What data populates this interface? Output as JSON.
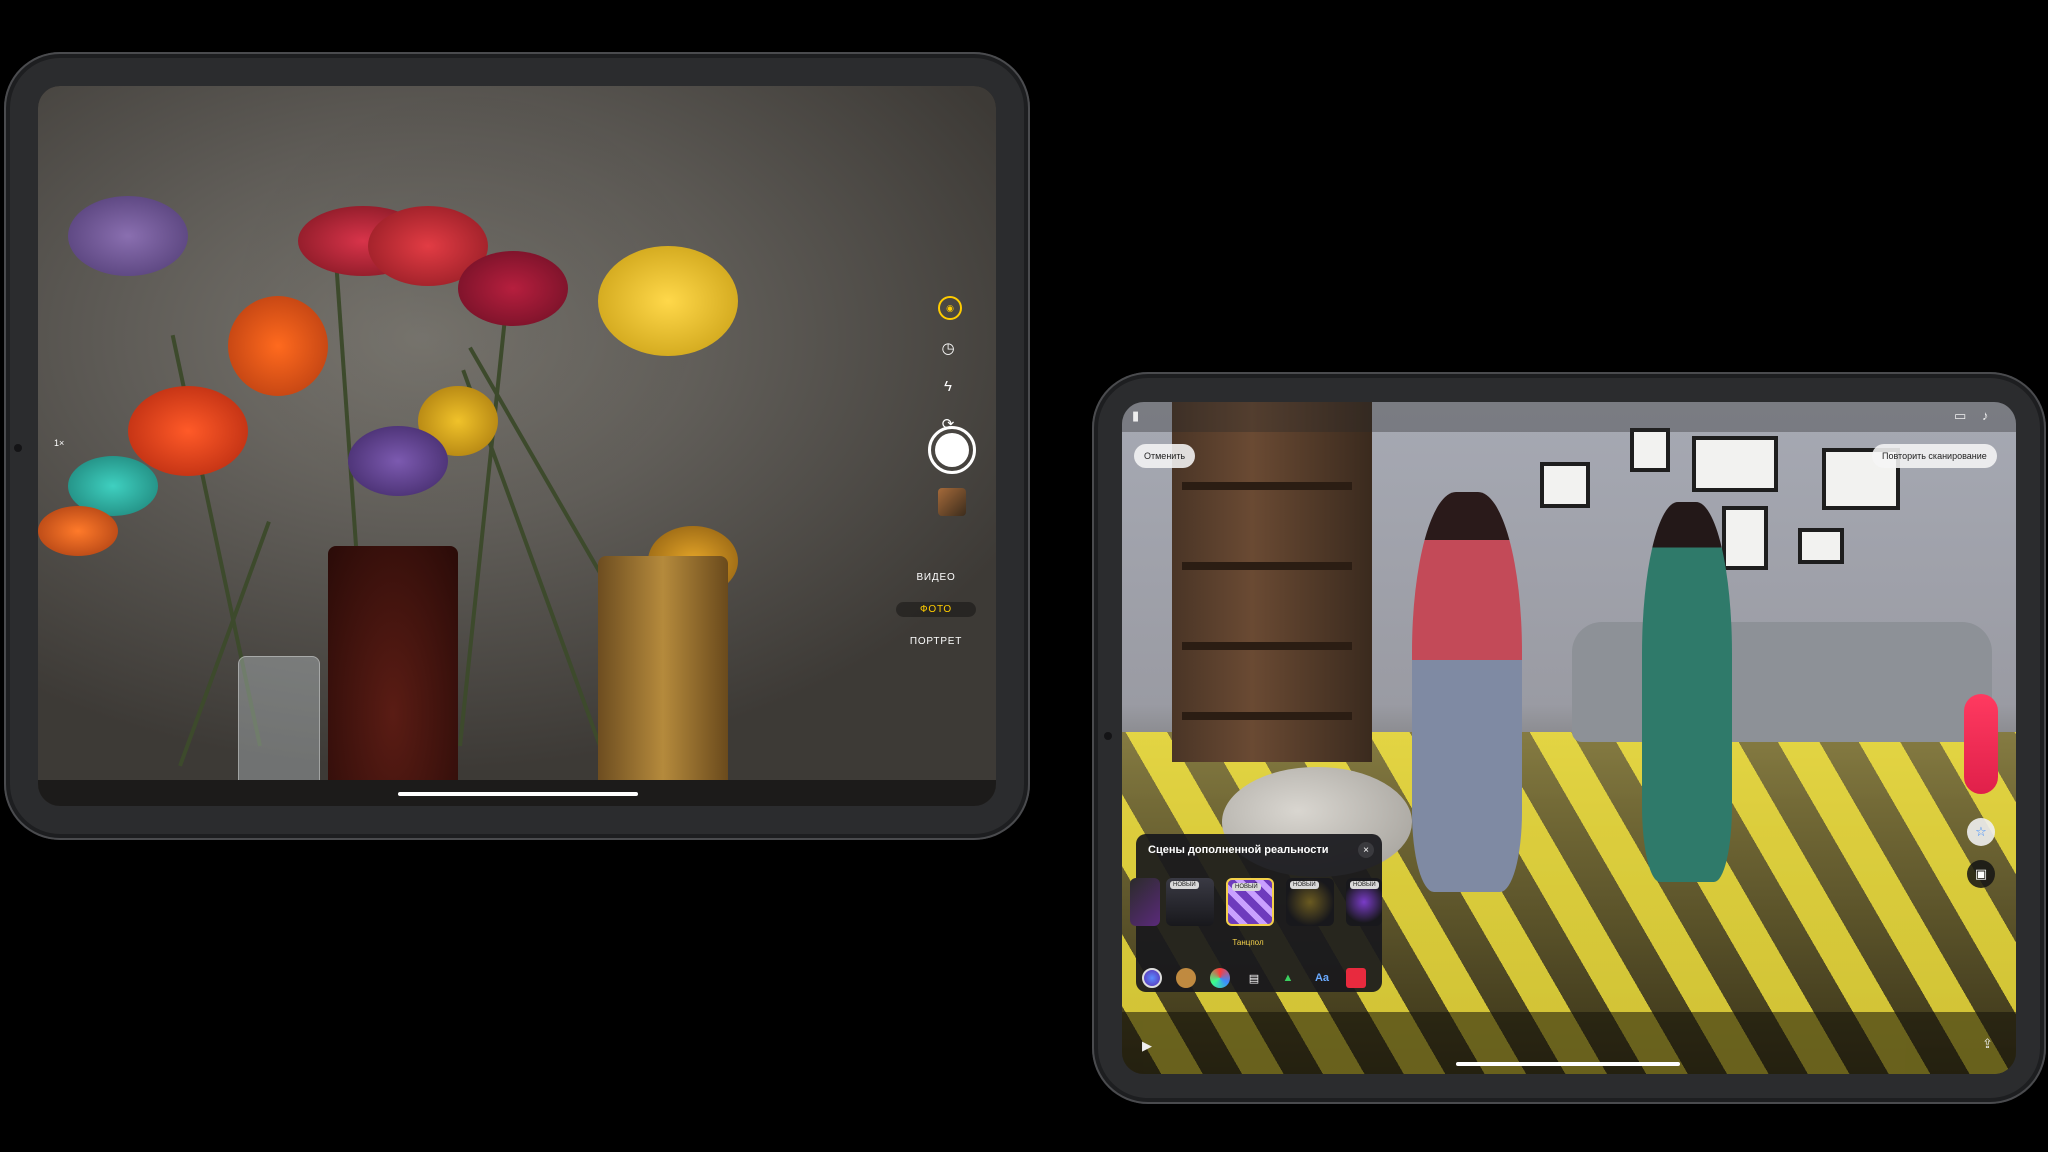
{
  "left_ipad": {
    "zoom_label": "1×",
    "modes": [
      "ВИДЕО",
      "ФОТО",
      "ПОРТРЕТ"
    ],
    "active_mode": "ФОТО",
    "accent_color": "#ffcc00",
    "icons": [
      "live-photo-icon",
      "timer-icon",
      "flash-icon",
      "switch-camera-icon",
      "shutter-button",
      "last-photo-thumbnail"
    ]
  },
  "right_ipad": {
    "cancel_label": "Отменить",
    "rescan_label": "Повторить сканирование",
    "ar_panel": {
      "title": "Сцены дополненной реальности",
      "new_badge": "НОВЫЙ",
      "selected_caption": "Танцпол",
      "close_symbol": "×"
    },
    "tools": [
      "ar-scenes-icon",
      "memoji-icon",
      "filters-icon",
      "speech-bubble-icon",
      "scenes-icon",
      "text-icon",
      "stickers-icon"
    ],
    "text_tool_label": "Aa",
    "record_color": "#ff3a60"
  }
}
